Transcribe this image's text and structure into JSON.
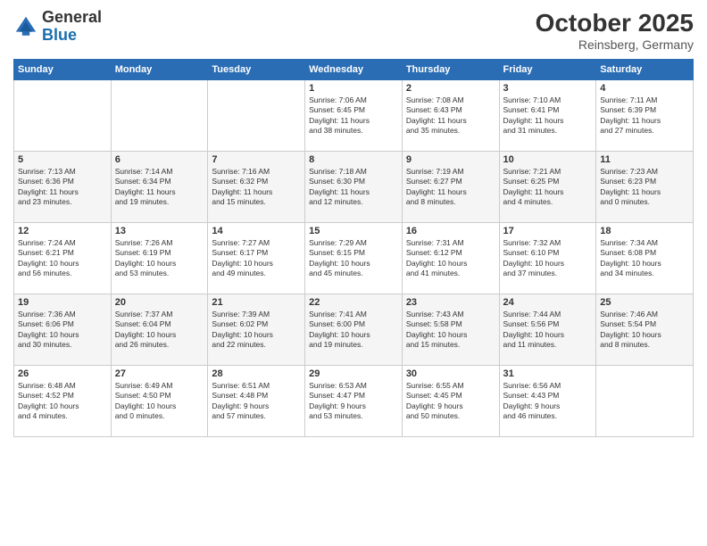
{
  "logo": {
    "general": "General",
    "blue": "Blue"
  },
  "title": "October 2025",
  "subtitle": "Reinsberg, Germany",
  "days_of_week": [
    "Sunday",
    "Monday",
    "Tuesday",
    "Wednesday",
    "Thursday",
    "Friday",
    "Saturday"
  ],
  "weeks": [
    [
      {
        "day": "",
        "info": ""
      },
      {
        "day": "",
        "info": ""
      },
      {
        "day": "",
        "info": ""
      },
      {
        "day": "1",
        "info": "Sunrise: 7:06 AM\nSunset: 6:45 PM\nDaylight: 11 hours\nand 38 minutes."
      },
      {
        "day": "2",
        "info": "Sunrise: 7:08 AM\nSunset: 6:43 PM\nDaylight: 11 hours\nand 35 minutes."
      },
      {
        "day": "3",
        "info": "Sunrise: 7:10 AM\nSunset: 6:41 PM\nDaylight: 11 hours\nand 31 minutes."
      },
      {
        "day": "4",
        "info": "Sunrise: 7:11 AM\nSunset: 6:39 PM\nDaylight: 11 hours\nand 27 minutes."
      }
    ],
    [
      {
        "day": "5",
        "info": "Sunrise: 7:13 AM\nSunset: 6:36 PM\nDaylight: 11 hours\nand 23 minutes."
      },
      {
        "day": "6",
        "info": "Sunrise: 7:14 AM\nSunset: 6:34 PM\nDaylight: 11 hours\nand 19 minutes."
      },
      {
        "day": "7",
        "info": "Sunrise: 7:16 AM\nSunset: 6:32 PM\nDaylight: 11 hours\nand 15 minutes."
      },
      {
        "day": "8",
        "info": "Sunrise: 7:18 AM\nSunset: 6:30 PM\nDaylight: 11 hours\nand 12 minutes."
      },
      {
        "day": "9",
        "info": "Sunrise: 7:19 AM\nSunset: 6:27 PM\nDaylight: 11 hours\nand 8 minutes."
      },
      {
        "day": "10",
        "info": "Sunrise: 7:21 AM\nSunset: 6:25 PM\nDaylight: 11 hours\nand 4 minutes."
      },
      {
        "day": "11",
        "info": "Sunrise: 7:23 AM\nSunset: 6:23 PM\nDaylight: 11 hours\nand 0 minutes."
      }
    ],
    [
      {
        "day": "12",
        "info": "Sunrise: 7:24 AM\nSunset: 6:21 PM\nDaylight: 10 hours\nand 56 minutes."
      },
      {
        "day": "13",
        "info": "Sunrise: 7:26 AM\nSunset: 6:19 PM\nDaylight: 10 hours\nand 53 minutes."
      },
      {
        "day": "14",
        "info": "Sunrise: 7:27 AM\nSunset: 6:17 PM\nDaylight: 10 hours\nand 49 minutes."
      },
      {
        "day": "15",
        "info": "Sunrise: 7:29 AM\nSunset: 6:15 PM\nDaylight: 10 hours\nand 45 minutes."
      },
      {
        "day": "16",
        "info": "Sunrise: 7:31 AM\nSunset: 6:12 PM\nDaylight: 10 hours\nand 41 minutes."
      },
      {
        "day": "17",
        "info": "Sunrise: 7:32 AM\nSunset: 6:10 PM\nDaylight: 10 hours\nand 37 minutes."
      },
      {
        "day": "18",
        "info": "Sunrise: 7:34 AM\nSunset: 6:08 PM\nDaylight: 10 hours\nand 34 minutes."
      }
    ],
    [
      {
        "day": "19",
        "info": "Sunrise: 7:36 AM\nSunset: 6:06 PM\nDaylight: 10 hours\nand 30 minutes."
      },
      {
        "day": "20",
        "info": "Sunrise: 7:37 AM\nSunset: 6:04 PM\nDaylight: 10 hours\nand 26 minutes."
      },
      {
        "day": "21",
        "info": "Sunrise: 7:39 AM\nSunset: 6:02 PM\nDaylight: 10 hours\nand 22 minutes."
      },
      {
        "day": "22",
        "info": "Sunrise: 7:41 AM\nSunset: 6:00 PM\nDaylight: 10 hours\nand 19 minutes."
      },
      {
        "day": "23",
        "info": "Sunrise: 7:43 AM\nSunset: 5:58 PM\nDaylight: 10 hours\nand 15 minutes."
      },
      {
        "day": "24",
        "info": "Sunrise: 7:44 AM\nSunset: 5:56 PM\nDaylight: 10 hours\nand 11 minutes."
      },
      {
        "day": "25",
        "info": "Sunrise: 7:46 AM\nSunset: 5:54 PM\nDaylight: 10 hours\nand 8 minutes."
      }
    ],
    [
      {
        "day": "26",
        "info": "Sunrise: 6:48 AM\nSunset: 4:52 PM\nDaylight: 10 hours\nand 4 minutes."
      },
      {
        "day": "27",
        "info": "Sunrise: 6:49 AM\nSunset: 4:50 PM\nDaylight: 10 hours\nand 0 minutes."
      },
      {
        "day": "28",
        "info": "Sunrise: 6:51 AM\nSunset: 4:48 PM\nDaylight: 9 hours\nand 57 minutes."
      },
      {
        "day": "29",
        "info": "Sunrise: 6:53 AM\nSunset: 4:47 PM\nDaylight: 9 hours\nand 53 minutes."
      },
      {
        "day": "30",
        "info": "Sunrise: 6:55 AM\nSunset: 4:45 PM\nDaylight: 9 hours\nand 50 minutes."
      },
      {
        "day": "31",
        "info": "Sunrise: 6:56 AM\nSunset: 4:43 PM\nDaylight: 9 hours\nand 46 minutes."
      },
      {
        "day": "",
        "info": ""
      }
    ]
  ]
}
